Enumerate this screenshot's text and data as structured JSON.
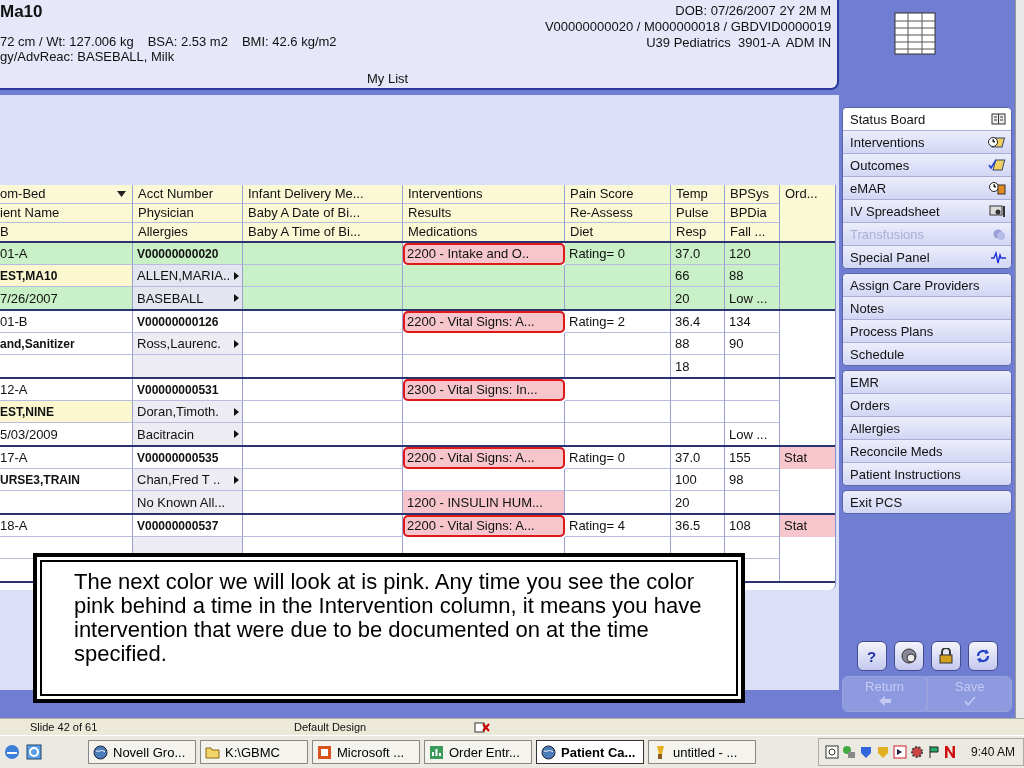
{
  "header": {
    "title": "Ma10",
    "measures": [
      "72 cm / Wt: 127.006 kg",
      "BSA: 2.53 m2",
      "BMI: 42.6 kg/m2"
    ],
    "allergy_line": "gy/AdvReac: BASEBALL, Milk",
    "right_lines": [
      "DOB: 07/26/2007 2Y 2M M",
      "V00000000020 / M000000018 / GBDVID0000019",
      "U39 Pediatrics  3901-A  ADM IN"
    ],
    "list_name": "My List"
  },
  "table": {
    "columns": [
      {
        "lines": [
          "om-Bed",
          "ient Name",
          "B"
        ],
        "sortable": true
      },
      {
        "lines": [
          "Acct Number",
          "Physician",
          "Allergies"
        ]
      },
      {
        "lines": [
          "Infant Delivery Me...",
          "Baby A Date of Bi...",
          "Baby A Time of Bi..."
        ]
      },
      {
        "lines": [
          "Interventions",
          "Results",
          "Medications"
        ]
      },
      {
        "lines": [
          "Pain Score",
          "Re-Assess",
          "Diet"
        ]
      },
      {
        "lines": [
          "Temp",
          "Pulse",
          "Resp"
        ]
      },
      {
        "lines": [
          "BPSys",
          "BPDia",
          "Fall ..."
        ]
      },
      {
        "lines": [
          "Ord..."
        ]
      }
    ],
    "patients": [
      {
        "selected": true,
        "flagged": true,
        "rows": [
          [
            {
              "text": "01-A"
            },
            {
              "text": "V00000000020"
            },
            null,
            {
              "text": "2200 - Intake and O..",
              "overdue": true,
              "outlined": true
            },
            {
              "text": "Rating= 0"
            },
            {
              "text": "37.0"
            },
            {
              "text": "120"
            },
            null
          ],
          [
            {
              "text": "EST,MA10"
            },
            {
              "text": "ALLEN,MARIA..",
              "menu": true
            },
            null,
            null,
            null,
            {
              "text": "66"
            },
            {
              "text": "88"
            },
            null
          ],
          [
            {
              "text": "7/26/2007"
            },
            {
              "text": "BASEBALL",
              "menu": true
            },
            null,
            null,
            null,
            {
              "text": "20"
            },
            {
              "text": "Low ..."
            },
            null
          ]
        ]
      },
      {
        "selected": false,
        "flagged": false,
        "rows": [
          [
            {
              "text": "01-B"
            },
            {
              "text": "V00000000126"
            },
            null,
            {
              "text": "2200 - Vital Signs: A...",
              "overdue": true,
              "outlined": true
            },
            {
              "text": "Rating= 2"
            },
            {
              "text": "36.4"
            },
            {
              "text": "134"
            },
            null
          ],
          [
            {
              "text": "and,Sanitizer"
            },
            {
              "text": "Ross,Laurenc.",
              "menu": true
            },
            null,
            null,
            null,
            {
              "text": "88"
            },
            {
              "text": "90"
            },
            null
          ],
          [
            null,
            null,
            null,
            null,
            null,
            {
              "text": "18"
            },
            null,
            null
          ]
        ]
      },
      {
        "selected": false,
        "flagged": true,
        "rows": [
          [
            {
              "text": "12-A"
            },
            {
              "text": "V00000000531"
            },
            null,
            {
              "text": "2300 - Vital Signs: In...",
              "overdue": true,
              "outlined": true
            },
            null,
            null,
            null,
            null
          ],
          [
            {
              "text": "EST,NINE"
            },
            {
              "text": "Doran,Timoth.",
              "menu": true
            },
            null,
            null,
            null,
            null,
            null,
            null
          ],
          [
            {
              "text": "5/03/2009"
            },
            {
              "text": "Bacitracin",
              "menu": true
            },
            null,
            null,
            null,
            null,
            {
              "text": "Low ..."
            },
            null
          ]
        ]
      },
      {
        "selected": false,
        "flagged": false,
        "rows": [
          [
            {
              "text": "17-A"
            },
            {
              "text": "V00000000535"
            },
            null,
            {
              "text": "2200 - Vital Signs: A...",
              "overdue": true,
              "outlined": true
            },
            {
              "text": "Rating= 0"
            },
            {
              "text": "37.0"
            },
            {
              "text": "155"
            },
            {
              "text": "Stat",
              "overdue": true
            }
          ],
          [
            {
              "text": "URSE3,TRAIN"
            },
            {
              "text": "Chan,Fred T ..",
              "menu": true
            },
            null,
            null,
            null,
            {
              "text": "100"
            },
            {
              "text": "98"
            },
            null
          ],
          [
            null,
            {
              "text": "No Known All..."
            },
            null,
            {
              "text": "1200 - INSULIN HUM...",
              "overdue": true
            },
            null,
            {
              "text": "20"
            },
            null,
            null
          ]
        ]
      },
      {
        "selected": false,
        "flagged": false,
        "rows": [
          [
            {
              "text": "18-A"
            },
            {
              "text": "V00000000537"
            },
            null,
            {
              "text": "2200 - Vital Signs: A...",
              "overdue": true,
              "outlined": true
            },
            {
              "text": "Rating= 4"
            },
            {
              "text": "36.5"
            },
            {
              "text": "108"
            },
            {
              "text": "Stat",
              "overdue": true
            }
          ]
        ]
      }
    ]
  },
  "sidebar": {
    "groups": [
      {
        "items": [
          {
            "label": "Status Board",
            "selected": true,
            "disabled": false
          },
          {
            "label": "Interventions",
            "selected": false,
            "disabled": false
          },
          {
            "label": "Outcomes",
            "selected": false,
            "disabled": false
          },
          {
            "label": "eMAR",
            "selected": false,
            "disabled": false
          },
          {
            "label": "IV Spreadsheet",
            "selected": false,
            "disabled": false
          },
          {
            "label": "Transfusions",
            "selected": false,
            "disabled": true
          },
          {
            "label": "Special Panel",
            "selected": false,
            "disabled": false
          }
        ]
      },
      {
        "items": [
          {
            "label": "Assign Care Providers",
            "selected": false,
            "disabled": false
          },
          {
            "label": "Notes",
            "selected": false,
            "disabled": false
          },
          {
            "label": "Process Plans",
            "selected": false,
            "disabled": false
          },
          {
            "label": "Schedule",
            "selected": false,
            "disabled": false
          }
        ]
      },
      {
        "items": [
          {
            "label": "EMR",
            "selected": false,
            "disabled": false
          },
          {
            "label": "Orders",
            "selected": false,
            "disabled": false
          },
          {
            "label": "Allergies",
            "selected": false,
            "disabled": false
          },
          {
            "label": "Reconcile Meds",
            "selected": false,
            "disabled": false
          },
          {
            "label": "Patient Instructions",
            "selected": false,
            "disabled": false
          }
        ]
      },
      {
        "items": [
          {
            "label": "Exit PCS",
            "selected": false,
            "disabled": false
          }
        ]
      }
    ],
    "help_label": "?",
    "actions": [
      {
        "label": "Return",
        "disabled": true
      },
      {
        "label": "Save",
        "disabled": true
      }
    ]
  },
  "callout": {
    "text": "The next color we will look at is pink. Any time you see the color pink behind a time in the Intervention column, it means you have intervention that were due to be documented on at the time specified."
  },
  "status_bar": {
    "slide": "Slide 42 of 61",
    "design": "Default Design"
  },
  "taskbar": {
    "tasks": [
      {
        "label": "Novell Gro...",
        "selected": false
      },
      {
        "label": "K:\\GBMC",
        "selected": false
      },
      {
        "label": "Microsoft ...",
        "selected": false
      },
      {
        "label": "Order Entr...",
        "selected": false
      },
      {
        "label": "Patient Ca...",
        "selected": true
      },
      {
        "label": "untitled - ...",
        "selected": false
      }
    ],
    "clock": "9:40 AM"
  }
}
